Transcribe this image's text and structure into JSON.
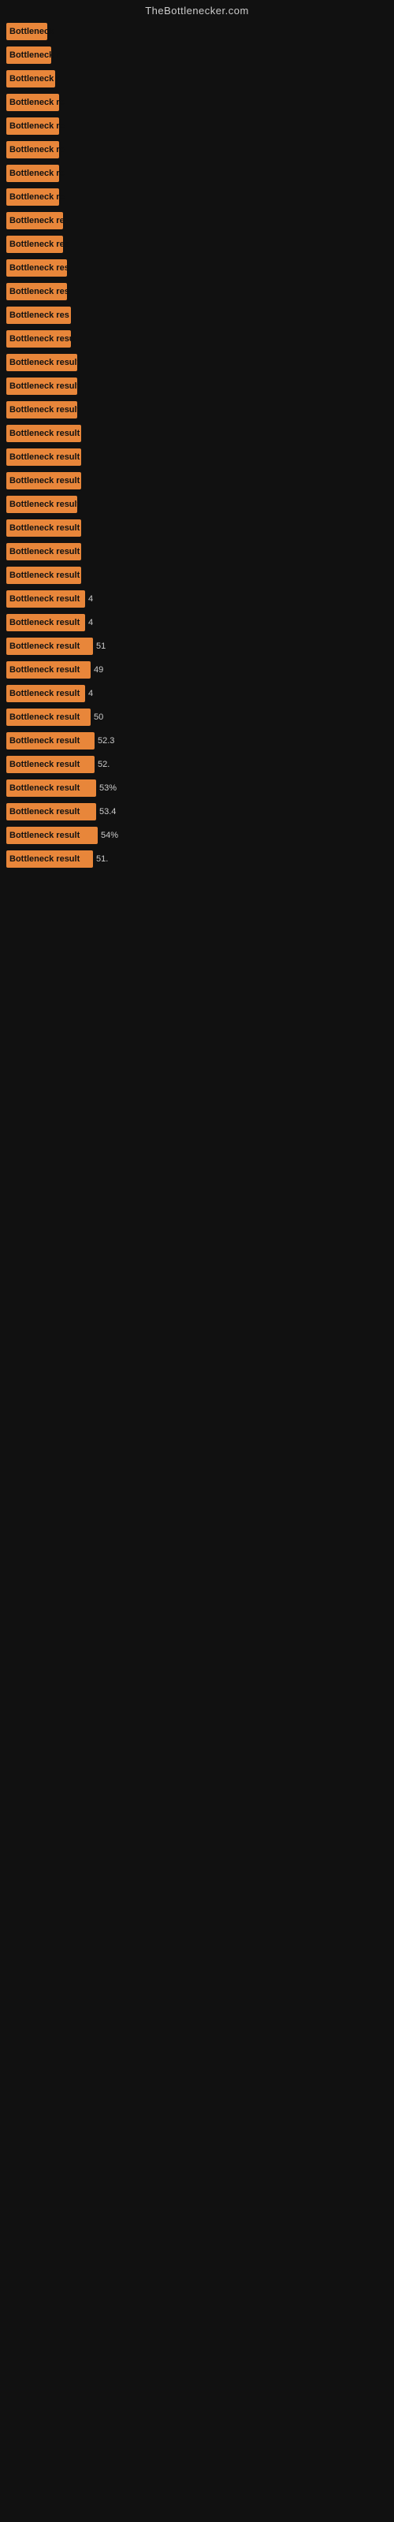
{
  "site_title": "TheBottlenecker.com",
  "bars": [
    {
      "label": "Bottleneck",
      "width": 52,
      "value": ""
    },
    {
      "label": "Bottleneck r",
      "width": 57,
      "value": ""
    },
    {
      "label": "Bottleneck r",
      "width": 62,
      "value": ""
    },
    {
      "label": "Bottleneck re",
      "width": 67,
      "value": ""
    },
    {
      "label": "Bottleneck re",
      "width": 67,
      "value": ""
    },
    {
      "label": "Bottleneck re",
      "width": 67,
      "value": ""
    },
    {
      "label": "Bottleneck re",
      "width": 67,
      "value": ""
    },
    {
      "label": "Bottleneck re",
      "width": 67,
      "value": ""
    },
    {
      "label": "Bottleneck re",
      "width": 72,
      "value": ""
    },
    {
      "label": "Bottleneck res",
      "width": 72,
      "value": ""
    },
    {
      "label": "Bottleneck res",
      "width": 77,
      "value": ""
    },
    {
      "label": "Bottleneck res",
      "width": 77,
      "value": ""
    },
    {
      "label": "Bottleneck res",
      "width": 82,
      "value": ""
    },
    {
      "label": "Bottleneck resu",
      "width": 82,
      "value": ""
    },
    {
      "label": "Bottleneck result",
      "width": 90,
      "value": ""
    },
    {
      "label": "Bottleneck result",
      "width": 90,
      "value": ""
    },
    {
      "label": "Bottleneck result",
      "width": 90,
      "value": ""
    },
    {
      "label": "Bottleneck result",
      "width": 95,
      "value": ""
    },
    {
      "label": "Bottleneck result",
      "width": 95,
      "value": ""
    },
    {
      "label": "Bottleneck result",
      "width": 95,
      "value": ""
    },
    {
      "label": "Bottleneck result",
      "width": 90,
      "value": ""
    },
    {
      "label": "Bottleneck result",
      "width": 95,
      "value": ""
    },
    {
      "label": "Bottleneck result",
      "width": 95,
      "value": ""
    },
    {
      "label": "Bottleneck result",
      "width": 95,
      "value": ""
    },
    {
      "label": "Bottleneck result",
      "width": 100,
      "value": "4"
    },
    {
      "label": "Bottleneck result",
      "width": 100,
      "value": "4"
    },
    {
      "label": "Bottleneck result",
      "width": 110,
      "value": "51"
    },
    {
      "label": "Bottleneck result",
      "width": 107,
      "value": "49"
    },
    {
      "label": "Bottleneck result",
      "width": 100,
      "value": "4"
    },
    {
      "label": "Bottleneck result",
      "width": 107,
      "value": "50"
    },
    {
      "label": "Bottleneck result",
      "width": 112,
      "value": "52.3"
    },
    {
      "label": "Bottleneck result",
      "width": 112,
      "value": "52."
    },
    {
      "label": "Bottleneck result",
      "width": 114,
      "value": "53%"
    },
    {
      "label": "Bottleneck result",
      "width": 114,
      "value": "53.4"
    },
    {
      "label": "Bottleneck result",
      "width": 116,
      "value": "54%"
    },
    {
      "label": "Bottleneck result",
      "width": 110,
      "value": "51."
    }
  ]
}
